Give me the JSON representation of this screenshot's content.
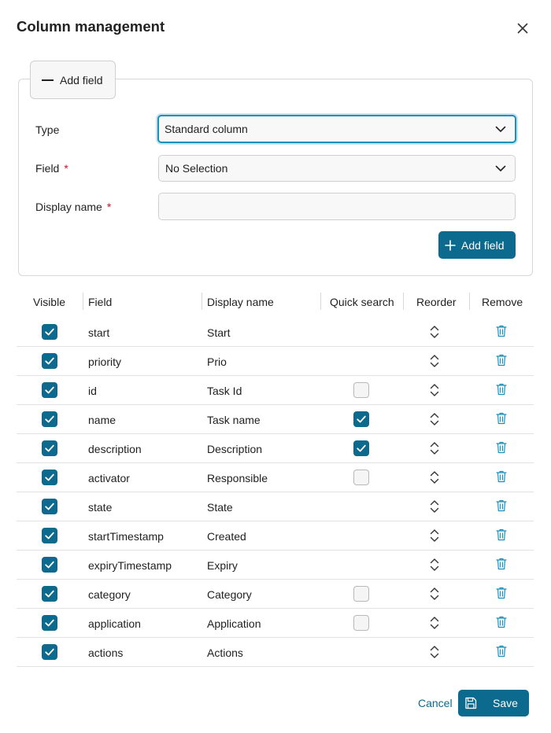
{
  "dialog": {
    "title": "Column management",
    "close_icon": "close-icon"
  },
  "add_panel": {
    "toggle_label": "Add field",
    "type_label": "Type",
    "type_value": "Standard column",
    "field_label": "Field",
    "field_value": "No Selection",
    "display_name_label": "Display name",
    "display_name_value": "",
    "required_marker": "*",
    "add_button_label": "Add field"
  },
  "table": {
    "headers": {
      "visible": "Visible",
      "field": "Field",
      "display_name": "Display name",
      "quick_search": "Quick search",
      "reorder": "Reorder",
      "remove": "Remove"
    },
    "rows": [
      {
        "field": "start",
        "display_name": "Start",
        "visible": true,
        "quick_search": null
      },
      {
        "field": "priority",
        "display_name": "Prio",
        "visible": true,
        "quick_search": null
      },
      {
        "field": "id",
        "display_name": "Task Id",
        "visible": true,
        "quick_search": false
      },
      {
        "field": "name",
        "display_name": "Task name",
        "visible": true,
        "quick_search": true
      },
      {
        "field": "description",
        "display_name": "Description",
        "visible": true,
        "quick_search": true
      },
      {
        "field": "activator",
        "display_name": "Responsible",
        "visible": true,
        "quick_search": false
      },
      {
        "field": "state",
        "display_name": "State",
        "visible": true,
        "quick_search": null
      },
      {
        "field": "startTimestamp",
        "display_name": "Created",
        "visible": true,
        "quick_search": null
      },
      {
        "field": "expiryTimestamp",
        "display_name": "Expiry",
        "visible": true,
        "quick_search": null
      },
      {
        "field": "category",
        "display_name": "Category",
        "visible": true,
        "quick_search": false
      },
      {
        "field": "application",
        "display_name": "Application",
        "visible": true,
        "quick_search": false
      },
      {
        "field": "actions",
        "display_name": "Actions",
        "visible": true,
        "quick_search": null
      }
    ]
  },
  "footer": {
    "cancel_label": "Cancel",
    "save_label": "Save"
  },
  "colors": {
    "accent": "#0c6a8e",
    "focus": "#1a8fb8",
    "required": "#c8102e"
  }
}
